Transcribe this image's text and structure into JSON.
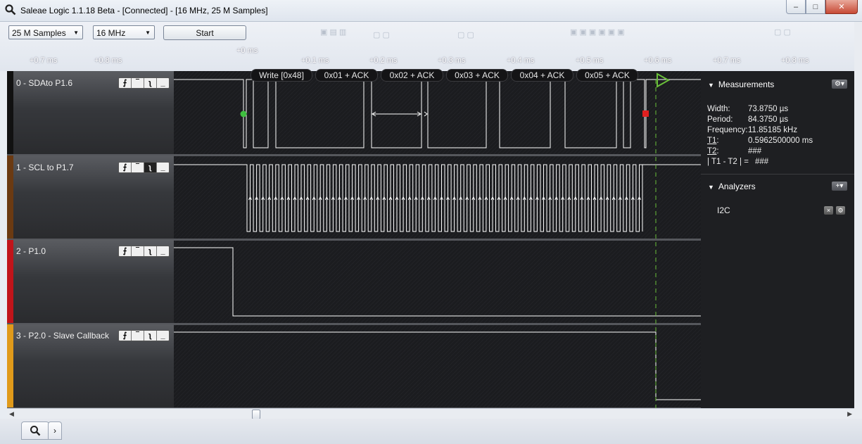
{
  "window": {
    "title": "Saleae Logic 1.1.18 Beta - [Connected] - [16 MHz, 25 M Samples]",
    "minimize": "–",
    "maximize": "□",
    "close": "✕"
  },
  "toolbar": {
    "samples_value": "25 M Samples",
    "rate_value": "16 MHz",
    "start_label": "Start"
  },
  "time_ticks": [
    "+0.7 ms",
    "+0.8 ms",
    "+0 ms",
    "+0.1 ms",
    "+0.2 ms",
    "+0.3 ms",
    "+0.4 ms",
    "+0.5 ms",
    "+0.6 ms",
    "+0.7 ms",
    "+0.8 ms"
  ],
  "channels": [
    {
      "label": "0 - SDAto P1.6",
      "color": "#111111"
    },
    {
      "label": "1 - SCL to P1.7",
      "color": "#6b3a12"
    },
    {
      "label": "2 - P1.0",
      "color": "#c0141a"
    },
    {
      "label": "3 - P2.0 - Slave Callback",
      "color": "#e09a1a"
    }
  ],
  "trigger_icons": [
    "rising-edge",
    "high",
    "falling-edge",
    "low"
  ],
  "i2c_frames": [
    "Write [0x48]",
    "0x01 + ACK",
    "0x02 + ACK",
    "0x03 + ACK",
    "0x04 + ACK",
    "0x05 + ACK"
  ],
  "measurements": {
    "header": "Measurements",
    "width_label": "Width:",
    "width_value": "73.8750 µs",
    "period_label": "Period:",
    "period_value": "84.3750 µs",
    "frequency_label": "Frequency:",
    "frequency_value": "11.85185 kHz",
    "t1_label": "T1",
    "t1_value": "0.5962500000 ms",
    "t2_label": "T2",
    "t2_value": "###",
    "diff_label": "| T1 - T2 | =",
    "diff_value": "###"
  },
  "analyzers": {
    "header": "Analyzers",
    "items": [
      "I2C"
    ]
  },
  "colors": {
    "waveform": "#ffffff",
    "marker_green": "#3fbf3f",
    "marker_red": "#e02020",
    "trigger_line": "#6abf3a"
  }
}
